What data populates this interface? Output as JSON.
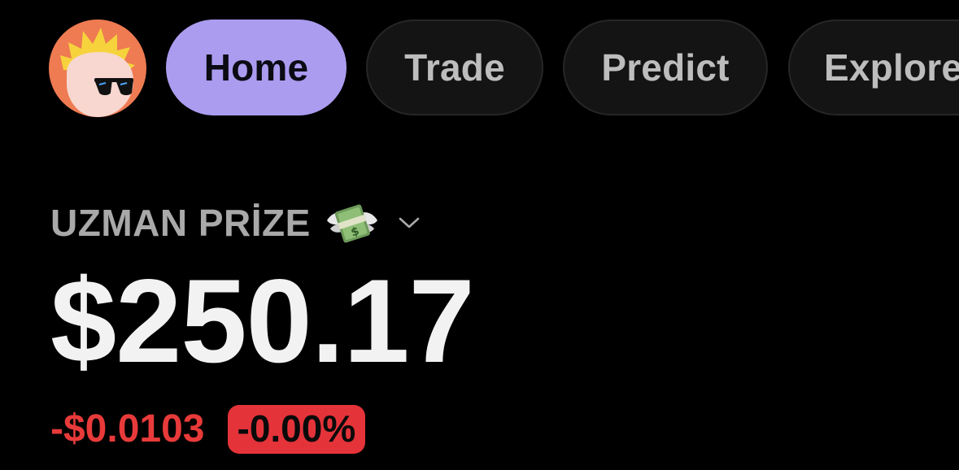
{
  "nav": {
    "avatar_icon": "cockatoo-sunglasses-avatar",
    "tabs": [
      {
        "label": "Home",
        "active": true
      },
      {
        "label": "Trade",
        "active": false
      },
      {
        "label": "Predict",
        "active": false
      },
      {
        "label": "Explore",
        "active": false
      }
    ]
  },
  "account": {
    "name": "UZMAN PRİZE",
    "emoji": "money-with-wings",
    "dropdown_icon": "chevron-down-icon"
  },
  "portfolio": {
    "balance": "$250.17",
    "change_amount": "-$0.0103",
    "change_percent": "-0.00%"
  },
  "colors": {
    "background": "#000000",
    "active_tab": "#ab9cf0",
    "negative": "#e83a3a",
    "avatar_bg": "#ee7b52"
  }
}
